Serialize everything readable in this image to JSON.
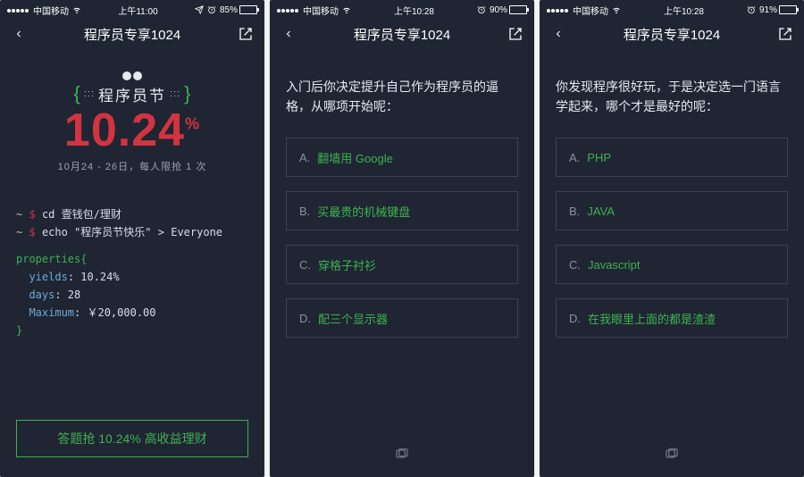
{
  "screens": [
    {
      "status": {
        "carrier": "中国移动",
        "time": "上午11:00",
        "batteryPct": "85%",
        "batteryFill": 85,
        "showLoc": true
      },
      "nav": {
        "title": "程序员专享1024"
      },
      "hero": {
        "festLabel": "程序员节",
        "bigNumber": "10.24",
        "bigPct": "%",
        "subLine": "10月24 - 26日，每人限抢 1 次"
      },
      "terminal": {
        "line1": {
          "tilde": "~",
          "dollar": "$",
          "cmd": "cd",
          "arg": "壹钱包/理财"
        },
        "line2": {
          "tilde": "~",
          "dollar": "$",
          "cmd": "echo",
          "str": "\"程序员节快乐\"",
          "gt": ">",
          "target": "Everyone"
        },
        "propsHead": "properties{",
        "yieldsK": "yields",
        "yieldsV": ": 10.24%",
        "daysK": "days",
        "daysV": ": 28",
        "maxK": "Maximum",
        "maxV": ": ￥20,000.00",
        "close": "}"
      },
      "cta": "答题抢 10.24% 高收益理财"
    },
    {
      "status": {
        "carrier": "中国移动",
        "time": "上午10:28",
        "batteryPct": "90%",
        "batteryFill": 90,
        "showLoc": false
      },
      "nav": {
        "title": "程序员专享1024"
      },
      "question": "入门后你决定提升自己作为程序员的逼格，从哪项开始呢：",
      "options": [
        {
          "label": "A.",
          "text": "翻墙用 Google"
        },
        {
          "label": "B.",
          "text": "买最贵的机械键盘"
        },
        {
          "label": "C.",
          "text": "穿格子衬衫"
        },
        {
          "label": "D.",
          "text": "配三个显示器"
        }
      ]
    },
    {
      "status": {
        "carrier": "中国移动",
        "time": "上午10:28",
        "batteryPct": "91%",
        "batteryFill": 91,
        "showLoc": false
      },
      "nav": {
        "title": "程序员专享1024"
      },
      "question": "你发现程序很好玩，于是决定选一门语言学起来，哪个才是最好的呢：",
      "options": [
        {
          "label": "A.",
          "text": "PHP"
        },
        {
          "label": "B.",
          "text": "JAVA"
        },
        {
          "label": "C.",
          "text": "Javascript"
        },
        {
          "label": "D.",
          "text": "在我眼里上面的都是渣渣"
        }
      ]
    }
  ]
}
